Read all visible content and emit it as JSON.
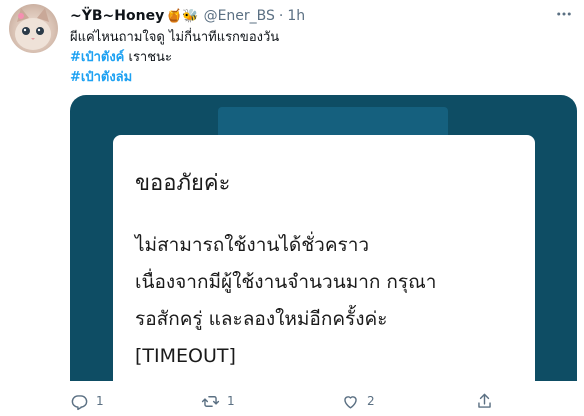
{
  "tweet": {
    "display_name": "~ŸB~Honey",
    "name_emojis": "🍯🐝",
    "handle": "@Ener_BS",
    "separator": "·",
    "time": "1h",
    "text_line1": "ผีแค่ไหนถามใจดู ไม่กี่นาทีแรกของวัน",
    "hashtag1": "#เป๋าตังค์",
    "text_line2_rest": " เราชนะ",
    "hashtag2": "#เป๋าตังล่ม"
  },
  "media": {
    "dialog_title": "ขออภัยค่ะ",
    "dialog_lines": [
      "ไม่สามารถใช้งานได้ชั่วคราว",
      "เนื่องจากมีผู้ใช้งานจำนวนมาก กรุณา",
      "รอสักครู่ และลองใหม่อีกครั้งค่ะ",
      "[TIMEOUT]"
    ]
  },
  "actions": {
    "reply_count": "1",
    "retweet_count": "1",
    "like_count": "2"
  },
  "colors": {
    "accent": "#1da1f2",
    "secondary_text": "#5b7083",
    "media_background": "#0e4d64"
  },
  "icons": [
    "more-icon",
    "reply-icon",
    "retweet-icon",
    "like-icon",
    "share-icon"
  ]
}
